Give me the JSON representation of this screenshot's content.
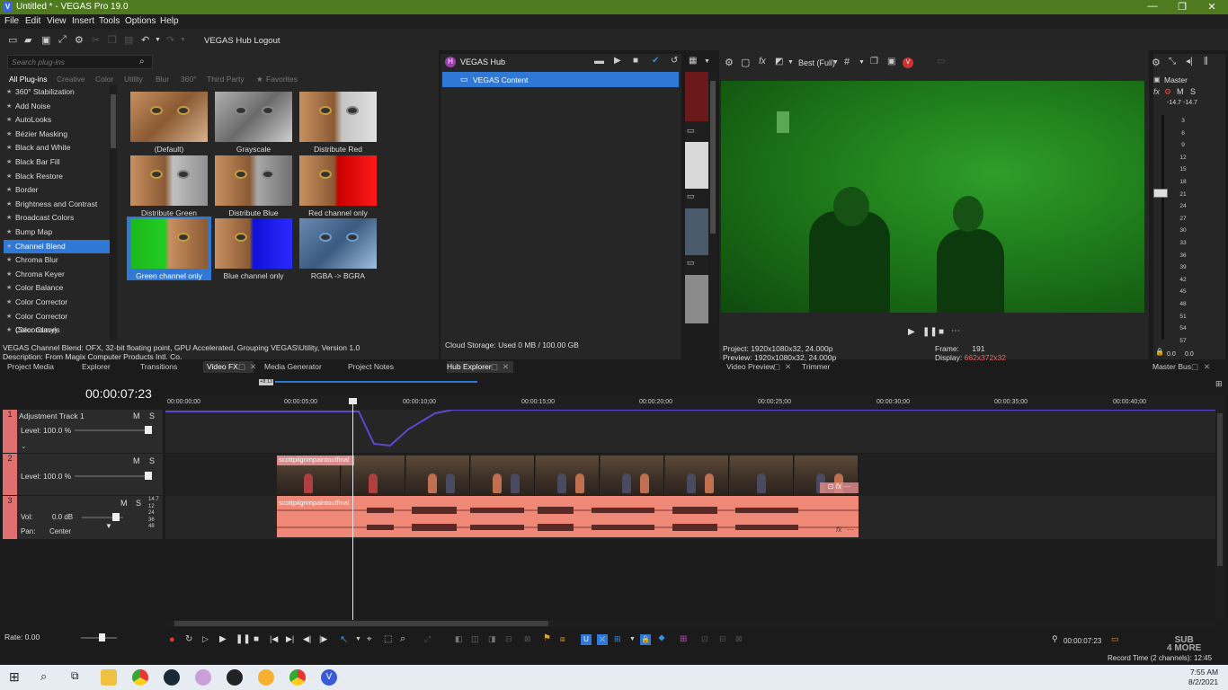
{
  "window": {
    "title": "Untitled * - VEGAS Pro 19.0",
    "logo_letter": "V",
    "minimize": "—",
    "maximize": "❐",
    "close": "✕"
  },
  "menu": [
    "File",
    "Edit",
    "View",
    "Insert",
    "Tools",
    "Options",
    "Help"
  ],
  "toolbar": {
    "hub_logout": "VEGAS Hub Logout",
    "hub_letter": "H"
  },
  "plugins": {
    "search_placeholder": "Search plug-ins",
    "tabs": [
      "All Plug-ins",
      "Creative",
      "Color",
      "Utility",
      "Blur",
      "360°",
      "Third Party",
      "Favorites"
    ],
    "items": [
      "360° Stabilization",
      "Add Noise",
      "AutoLooks",
      "Bézier Masking",
      "Black and White",
      "Black Bar Fill",
      "Black Restore",
      "Border",
      "Brightness and Contrast",
      "Broadcast Colors",
      "Bump Map",
      "Channel Blend",
      "Chroma Blur",
      "Chroma Keyer",
      "Color Balance",
      "Color Corrector",
      "Color Corrector (Secondary)",
      "Color Curves"
    ],
    "selected": "Channel Blend",
    "presets": [
      "(Default)",
      "Grayscale",
      "Distribute Red",
      "Distribute Green",
      "Distribute Blue",
      "Red channel only",
      "Green channel only",
      "Blue channel only",
      "RGBA -> BGRA"
    ],
    "selected_preset": "Green channel only",
    "info_line1": "VEGAS Channel Blend: OFX, 32-bit floating point, GPU Accelerated, Grouping VEGAS\\Utility, Version 1.0",
    "info_line2": "Description: From Magix Computer Products Intl. Co."
  },
  "dock_tabs_left": [
    "Project Media",
    "Explorer",
    "Transitions",
    "Video FX",
    "Media Generator",
    "Project Notes"
  ],
  "hub": {
    "title": "VEGAS Hub",
    "item": "VEGAS Content",
    "storage": "Cloud Storage: Used 0 MB / 100.00 GB",
    "tab": "Hub Explorer"
  },
  "preview": {
    "quality": "Best (Full)",
    "project_label": "Project:",
    "project_val": "1920x1080x32, 24.000p",
    "preview_label": "Preview:",
    "preview_val": "1920x1080x32, 24.000p",
    "frame_label": "Frame:",
    "frame_val": "191",
    "display_label": "Display:",
    "display_val": "662x372x32",
    "tabs": [
      "Video Preview",
      "Trimmer"
    ]
  },
  "master": {
    "label": "Master",
    "m": "M",
    "s": "S",
    "left": "-14.7",
    "right": "-14.7",
    "scale": [
      "3",
      "6",
      "9",
      "12",
      "15",
      "18",
      "21",
      "24",
      "27",
      "30",
      "33",
      "36",
      "39",
      "42",
      "45",
      "48",
      "51",
      "54",
      "57"
    ],
    "bottom_l": "0.0",
    "bottom_r": "0.0",
    "tab": "Master Bus"
  },
  "timeline": {
    "timecode": "00:00:07:23",
    "loop_marker": "+8:13",
    "ruler": [
      "00:00:00;00",
      "00:00:05;00",
      "00:00:10;00",
      "00:00:15;00",
      "00:00:20;00",
      "00:00:25;00",
      "00:00:30;00",
      "00:00:35;00",
      "00:00:40;00"
    ],
    "tracks": [
      {
        "num": "1",
        "name": "Adjustment Track 1",
        "level": "Level: 100.0 %",
        "m": "M",
        "s": "S"
      },
      {
        "num": "2",
        "level": "Level: 100.0 %",
        "m": "M",
        "s": "S"
      },
      {
        "num": "3",
        "vol_label": "Vol:",
        "vol": "0.0 dB",
        "pan_label": "Pan:",
        "pan": "Center",
        "m": "M",
        "s": "S",
        "scale": [
          "14.7",
          "12",
          "24",
          "36",
          "48"
        ]
      }
    ],
    "video_clip": "scottpilgrimpaintoutfinal",
    "audio_clip": "scottpilgrimpaintoutfinal",
    "fx": "fx"
  },
  "transport": {
    "rate": "Rate: 0.00",
    "cursor_time": "00:00:07:23",
    "record_time": "Record Time (2 channels): 12:45"
  },
  "watermark": {
    "line1": "SUB",
    "line2": "4 MORE"
  },
  "taskbar": {
    "time": "7:55 AM",
    "date": "8/2/2021"
  }
}
